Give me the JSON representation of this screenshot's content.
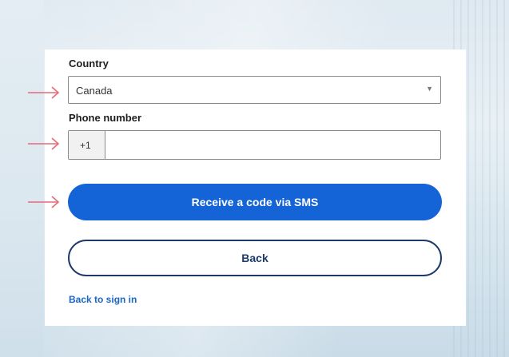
{
  "form": {
    "country_label": "Country",
    "country_value": "Canada",
    "phone_label": "Phone number",
    "phone_prefix": "+1",
    "phone_value": "",
    "submit_label": "Receive a code via SMS",
    "back_label": "Back",
    "back_to_signin_label": "Back to sign in"
  },
  "colors": {
    "primary": "#1464d8",
    "secondary_border": "#1d3a6b",
    "link": "#1a66c9",
    "arrow": "#e46b7a"
  },
  "icons": {
    "select_caret": "chevron-down-icon",
    "annotation": "arrow-right-icon"
  }
}
